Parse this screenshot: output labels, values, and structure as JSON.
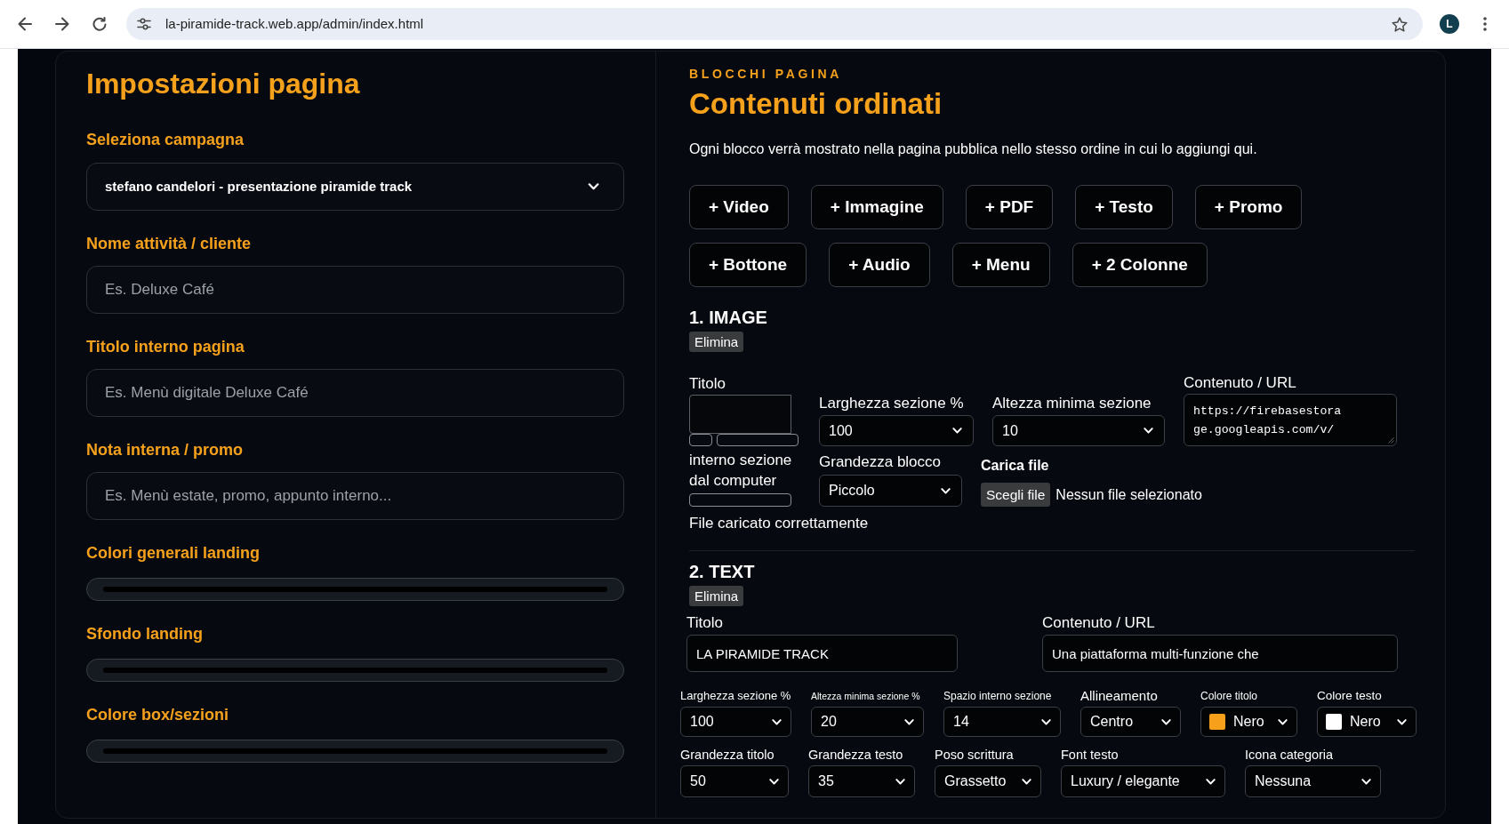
{
  "browser": {
    "url": "la-piramide-track.web.app/admin/index.html",
    "profile_initial": "L"
  },
  "settings_panel": {
    "title": "Impostazioni pagina",
    "fields": [
      {
        "kind": "select",
        "label": "Seleziona campagna",
        "value": "stefano candelori - presentazione piramide track"
      },
      {
        "kind": "text",
        "label": "Nome attività / cliente",
        "placeholder": "Es. Deluxe Café"
      },
      {
        "kind": "text",
        "label": "Titolo interno pagina",
        "placeholder": "Es. Menù digitale Deluxe Café"
      },
      {
        "kind": "text",
        "label": "Nota interna / promo",
        "placeholder": "Es. Menù estate, promo, appunto interno..."
      },
      {
        "kind": "color",
        "label": "Colori generali landing",
        "color": "#000000"
      },
      {
        "kind": "color",
        "label": "Sfondo landing",
        "color": "#000000"
      },
      {
        "kind": "color",
        "label": "Colore box/sezioni",
        "color": "#000000"
      }
    ]
  },
  "blocks_panel": {
    "eyebrow": "BLOCCHI PAGINA",
    "title": "Contenuti ordinati",
    "description": "Ogni blocco verrà mostrato nella pagina pubblica nello stesso ordine in cui lo aggiungi qui.",
    "add_buttons": [
      "+ Video",
      "+ Immagine",
      "+ PDF",
      "+ Testo",
      "+ Promo",
      "+ Bottone",
      "+ Audio",
      "+ Menu",
      "+ 2 Colonne"
    ],
    "blocks": [
      {
        "kind": "image",
        "heading": "1. IMAGE",
        "delete_label": "Elimina",
        "title_label": "Titolo",
        "clipped_label_lines": [
          "interno sezione",
          "dal computer"
        ],
        "width": {
          "label": "Larghezza sezione %",
          "value": "100"
        },
        "min_height": {
          "label": "Altezza minima sezione",
          "value": "10"
        },
        "content": {
          "label": "Contenuto / URL",
          "value": "https://firebasestorage.googleapis.com/v/"
        },
        "block_size": {
          "label": "Grandezza blocco",
          "value": "Piccolo"
        },
        "upload": {
          "label": "Carica file",
          "button": "Scegli file",
          "status": "Nessun file selezionato"
        },
        "message": "File caricato correttamente"
      },
      {
        "kind": "text",
        "heading": "2. TEXT",
        "delete_label": "Elimina",
        "title": {
          "label": "Titolo",
          "value": "LA PIRAMIDE TRACK"
        },
        "content": {
          "label": "Contenuto / URL",
          "value": "Una piattaforma multi-funzione che"
        },
        "option_rows": [
          [
            {
              "kind": "select",
              "label": "Larghezza sezione %",
              "value": "100"
            },
            {
              "kind": "select",
              "label": "Altezza minima sezione %",
              "value": "20"
            },
            {
              "kind": "select",
              "label": "Spazio interno sezione",
              "value": "14"
            },
            {
              "kind": "select",
              "label": "Allineamento",
              "value": "Centro"
            },
            {
              "kind": "color",
              "label": "Colore titolo",
              "value": "Nero",
              "color": "#f7a01c"
            },
            {
              "kind": "color",
              "label": "Colore testo",
              "value": "Nero",
              "color": "#ffffff"
            }
          ],
          [
            {
              "kind": "select",
              "label": "Grandezza titolo",
              "value": "50"
            },
            {
              "kind": "select",
              "label": "Grandezza testo",
              "value": "35"
            },
            {
              "kind": "select",
              "label": "Poso scrittura",
              "value": "Grassetto"
            },
            {
              "kind": "select",
              "label": "Font testo",
              "value": "Luxury / elegante"
            },
            {
              "kind": "select",
              "label": "Icona categoria",
              "value": "Nessuna"
            }
          ]
        ]
      }
    ]
  }
}
